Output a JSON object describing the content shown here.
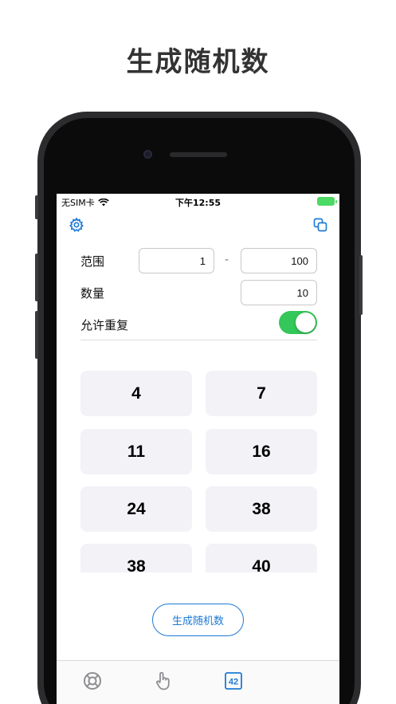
{
  "headline": "生成随机数",
  "statusbar": {
    "carrier": "无SIM卡",
    "time": "下午12:55"
  },
  "toolbar": {
    "settings_icon": "gear-icon",
    "copy_icon": "copy-icon"
  },
  "form": {
    "range_label": "范围",
    "range_min": "1",
    "range_separator": "-",
    "range_max": "100",
    "count_label": "数量",
    "count_value": "10",
    "allow_repeat_label": "允许重复",
    "allow_repeat_on": true
  },
  "results": [
    "4",
    "7",
    "11",
    "16",
    "24",
    "38",
    "38",
    "40"
  ],
  "generate_button": "生成随机数",
  "tabbar": {
    "tabs": [
      {
        "icon": "lifebuoy-icon",
        "active": false
      },
      {
        "icon": "tap-hand-icon",
        "active": false
      },
      {
        "icon": "number-badge-icon",
        "label": "42",
        "active": true
      }
    ]
  },
  "colors": {
    "accent": "#1e7ad4",
    "toggle_on": "#34c759",
    "cell_bg": "#f2f2f7"
  }
}
